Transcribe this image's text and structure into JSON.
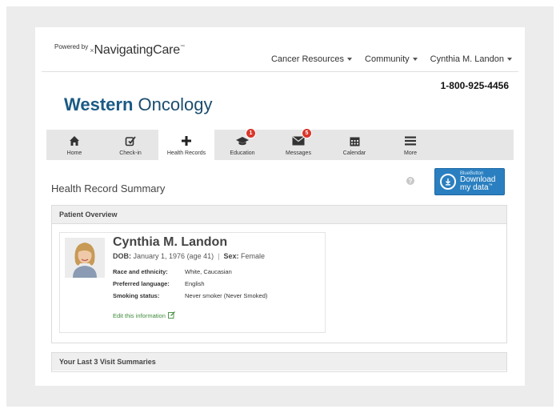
{
  "header": {
    "powered_by": "Powered by",
    "brand_name": "NavigatingCare",
    "trademark": "™",
    "nav": [
      {
        "label": "Cancer Resources"
      },
      {
        "label": "Community"
      },
      {
        "label": "Cynthia M. Landon"
      }
    ],
    "phone": "1-800-925-4456"
  },
  "clinic": {
    "name_bold": "Western",
    "name_rest": " Oncology",
    "color": "#1a5a84"
  },
  "tabs": [
    {
      "label": "Home",
      "icon": "home-icon"
    },
    {
      "label": "Check-in",
      "icon": "checkin-icon"
    },
    {
      "label": "Health Records",
      "icon": "plus-icon",
      "active": true
    },
    {
      "label": "Education",
      "icon": "graduation-cap-icon",
      "badge": "1"
    },
    {
      "label": "Messages",
      "icon": "envelope-icon",
      "badge": "5"
    },
    {
      "label": "Calendar",
      "icon": "calendar-icon"
    },
    {
      "label": "More",
      "icon": "menu-icon"
    }
  ],
  "summary": {
    "title": "Health Record Summary",
    "help": "?",
    "bluebutton": {
      "small": "BlueButton",
      "line1": "Download",
      "line2": "my data",
      "tm": "™",
      "color": "#2a7fc0"
    }
  },
  "overview": {
    "heading": "Patient Overview",
    "patient": {
      "name": "Cynthia M. Landon",
      "dob_label": "DOB:",
      "dob_value": "January 1, 1976 (age 41)",
      "separator": "|",
      "sex_label": "Sex:",
      "sex_value": "Female",
      "fields": [
        {
          "key": "Race and ethnicity:",
          "value": "White, Caucasian"
        },
        {
          "key": "Preferred language:",
          "value": "English"
        },
        {
          "key": "Smoking status:",
          "value": "Never smoker (Never Smoked)"
        }
      ],
      "edit_label": "Edit this information"
    }
  },
  "visits": {
    "heading": "Your Last 3 Visit Summaries"
  },
  "colors": {
    "badge": "#d9362b",
    "edit_link": "#3f8a3a"
  }
}
